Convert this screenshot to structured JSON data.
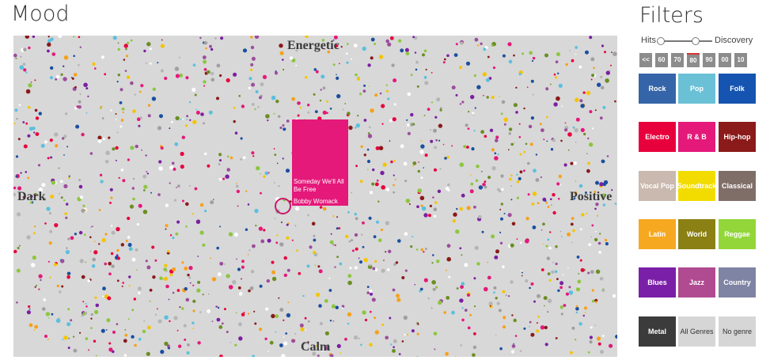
{
  "mood": {
    "title": "Mood",
    "labels": {
      "top": "Energetic",
      "bottom": "Calm",
      "left": "Dark",
      "right": "Positive"
    },
    "popup": {
      "song": "Someday We'll All Be Free",
      "artist": "Bobby Womack",
      "color": "#e4197a"
    },
    "dot_colors": [
      "#e4197a",
      "#1a4fa0",
      "#5bc0de",
      "#f5c400",
      "#8cc63f",
      "#7b1fa2",
      "#f6a11b",
      "#8b1a1a",
      "#a0a0a0",
      "#ffffff",
      "#6b8e23",
      "#b5b5b5",
      "#e8003d",
      "#9c4d9c"
    ]
  },
  "filters": {
    "title": "Filters",
    "slider": {
      "left_label": "Hits",
      "right_label": "Discovery"
    },
    "decades": [
      "<<",
      "60",
      "70",
      "80",
      "90",
      "00",
      "10"
    ],
    "selected_decade": "80",
    "genres": [
      {
        "label": "Rock",
        "color": "#3565a8"
      },
      {
        "label": "Pop",
        "color": "#6ac1d6"
      },
      {
        "label": "Folk",
        "color": "#1554b0"
      },
      {
        "label": "Electro",
        "color": "#e8003d"
      },
      {
        "label": "R & B",
        "color": "#e4197a"
      },
      {
        "label": "Hip-hop",
        "color": "#8b1a1a"
      },
      {
        "label": "Vocal Pop",
        "color": "#c9b9ae"
      },
      {
        "label": "Soundtrack",
        "color": "#f2dc00"
      },
      {
        "label": "Classical",
        "color": "#7f6e68"
      },
      {
        "label": "Latin",
        "color": "#f6a820"
      },
      {
        "label": "World",
        "color": "#8a8014"
      },
      {
        "label": "Reggae",
        "color": "#92d63a"
      },
      {
        "label": "Blues",
        "color": "#7a1fa8"
      },
      {
        "label": "Jazz",
        "color": "#b04a91"
      },
      {
        "label": "Country",
        "color": "#7f84a4"
      },
      {
        "label": "Metal",
        "color": "#3b3b3b"
      },
      {
        "label": "All Genres",
        "color": "#d6d6d6"
      },
      {
        "label": "No genre",
        "color": "#d6d6d6"
      }
    ]
  }
}
